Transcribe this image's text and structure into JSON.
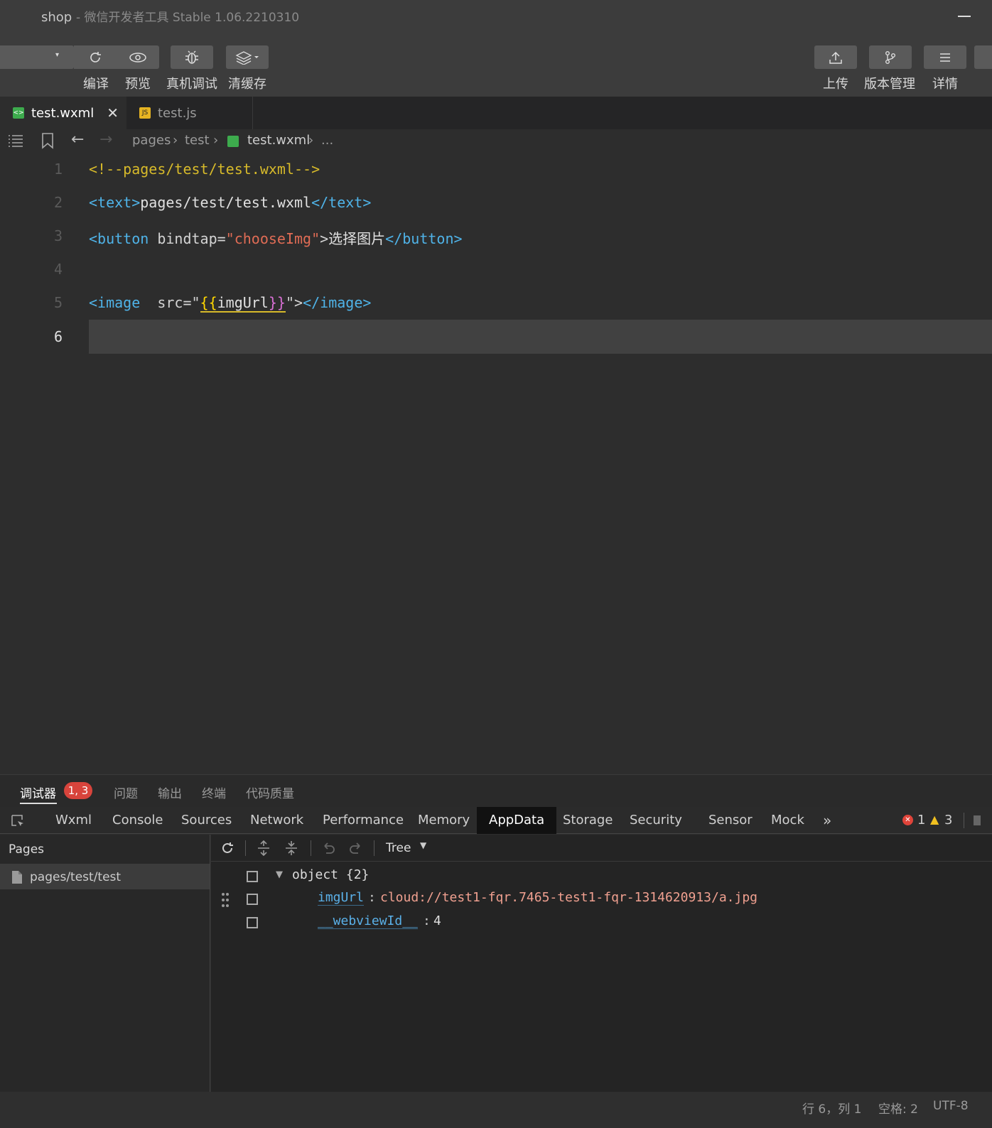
{
  "window": {
    "title": "shop",
    "subtitle": "- 微信开发者工具 Stable 1.06.2210310"
  },
  "toolbar": {
    "compile": "编译",
    "preview": "预览",
    "remote_debug": "真机调试",
    "clear_cache": "清缓存",
    "upload": "上传",
    "version": "版本管理",
    "details": "详情"
  },
  "tabs": [
    {
      "label": "test.wxml",
      "icon": "wxml-file-icon"
    },
    {
      "label": "test.js",
      "icon": "js-file-icon"
    }
  ],
  "breadcrumb": {
    "p1": "pages",
    "p2": "test",
    "p3": "test.wxml",
    "p4": "..."
  },
  "editor": {
    "line_numbers": [
      "1",
      "2",
      "3",
      "4",
      "5",
      "6"
    ],
    "line1": "<!--pages/test/test.wxml-->",
    "line2": {
      "open": "<text>",
      "text": "pages/test/test.wxml",
      "close": "</text>"
    },
    "line3": {
      "open": "<button",
      "attr": " bindtap=",
      "value": "\"chooseImg\"",
      "gt": ">",
      "text": "选择图片",
      "close": "</button>"
    },
    "line5": {
      "open": "<image",
      "attr": "  src=",
      "q1": "\"",
      "b1": "{{",
      "expr": "imgUrl",
      "b2": "}}",
      "q2": "\"",
      "gt": ">",
      "close": "</image>"
    }
  },
  "bottom_tabs": {
    "debugger": "调试器",
    "badge": "1, 3",
    "issues": "问题",
    "output": "输出",
    "terminal": "终端",
    "quality": "代码质量"
  },
  "devtools_tabs": [
    "Wxml",
    "Console",
    "Sources",
    "Network",
    "Performance",
    "Memory",
    "AppData",
    "Storage",
    "Security",
    "Sensor",
    "Mock"
  ],
  "devtools_status": {
    "errors": "1",
    "warnings": "3"
  },
  "pages_panel": {
    "header": "Pages",
    "item": "pages/test/test"
  },
  "appdata": {
    "view_mode": "Tree",
    "root": "object {2}",
    "rows": [
      {
        "key": "imgUrl",
        "value": "cloud://test1-fqr.7465-test1-fqr-1314620913/a.jpg"
      },
      {
        "key": "__webviewId__",
        "value": "4"
      }
    ]
  },
  "status": {
    "position": "行 6，列 1",
    "indent": "空格: 2",
    "encoding": "UTF-8"
  },
  "colors": {
    "accent_badge": "#d8443c",
    "tag": "#4fb3e8",
    "string": "#e06c55",
    "comment": "#d7ba2a"
  }
}
